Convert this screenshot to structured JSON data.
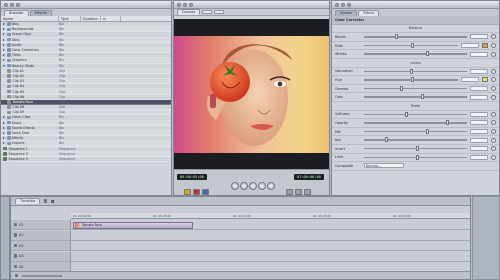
{
  "browser": {
    "tabs": [
      "Browser",
      "Effects"
    ],
    "columns": [
      "Name",
      "Type",
      "Duration",
      "In"
    ],
    "rows": [
      {
        "name": "Bins",
        "type": "Bin",
        "dur": "",
        "icon": "bin",
        "indent": 0,
        "open": false
      },
      {
        "name": "Backgrounds",
        "type": "Bin",
        "dur": "",
        "icon": "bin",
        "indent": 0,
        "open": false
      },
      {
        "name": "Scene Clips",
        "type": "Bin",
        "dur": "",
        "icon": "bin",
        "indent": 0,
        "open": false
      },
      {
        "name": "Stills",
        "type": "Bin",
        "dur": "",
        "icon": "bin",
        "indent": 0,
        "open": false
      },
      {
        "name": "Audio",
        "type": "Bin",
        "dur": "",
        "icon": "bin",
        "indent": 0,
        "open": false
      },
      {
        "name": "Color Correction",
        "type": "Bin",
        "dur": "",
        "icon": "bin",
        "indent": 0,
        "open": false
      },
      {
        "name": "Titles",
        "type": "Bin",
        "dur": "",
        "icon": "bin",
        "indent": 0,
        "open": false
      },
      {
        "name": "Graphics",
        "type": "Bin",
        "dur": "",
        "icon": "bin",
        "indent": 0,
        "open": false
      },
      {
        "name": "Beauty Shots",
        "type": "Bin",
        "dur": "",
        "icon": "bin",
        "indent": 0,
        "open": true
      },
      {
        "name": "Clip 01",
        "type": "Clip",
        "dur": "",
        "icon": "clip",
        "indent": 1,
        "open": false
      },
      {
        "name": "Clip 02",
        "type": "Clip",
        "dur": "",
        "icon": "clip",
        "indent": 1,
        "open": false
      },
      {
        "name": "Clip 03",
        "type": "Clip",
        "dur": "",
        "icon": "clip",
        "indent": 1,
        "open": false
      },
      {
        "name": "Clip 04",
        "type": "Clip",
        "dur": "",
        "icon": "clip",
        "indent": 1,
        "open": false
      },
      {
        "name": "Clip 05",
        "type": "Clip",
        "dur": "",
        "icon": "clip",
        "indent": 1,
        "open": false
      },
      {
        "name": "Clip 06",
        "type": "Clip",
        "dur": "",
        "icon": "clip",
        "indent": 1,
        "open": false
      },
      {
        "name": "Tomato Face",
        "type": "Clip",
        "dur": "",
        "icon": "clip",
        "indent": 1,
        "open": false,
        "selected": true
      },
      {
        "name": "Clip 08",
        "type": "Clip",
        "dur": "",
        "icon": "clip",
        "indent": 1,
        "open": false
      },
      {
        "name": "Clip 09",
        "type": "Clip",
        "dur": "",
        "icon": "clip",
        "indent": 1,
        "open": false
      },
      {
        "name": "Other Clips",
        "type": "Bin",
        "dur": "",
        "icon": "bin",
        "indent": 0,
        "open": false
      },
      {
        "name": "Music",
        "type": "Bin",
        "dur": "",
        "icon": "bin",
        "indent": 0,
        "open": false
      },
      {
        "name": "Sound Effects",
        "type": "Bin",
        "dur": "",
        "icon": "bin",
        "indent": 0,
        "open": false
      },
      {
        "name": "Voice Over",
        "type": "Bin",
        "dur": "",
        "icon": "bin",
        "indent": 0,
        "open": false
      },
      {
        "name": "Effects",
        "type": "Bin",
        "dur": "",
        "icon": "bin",
        "indent": 0,
        "open": false
      },
      {
        "name": "Exports",
        "type": "Bin",
        "dur": "",
        "icon": "bin",
        "indent": 0,
        "open": false
      },
      {
        "name": "Sequence 1",
        "type": "Sequence",
        "dur": "",
        "icon": "seq",
        "indent": 0,
        "open": false
      },
      {
        "name": "Sequence 2",
        "type": "Sequence",
        "dur": "",
        "icon": "seq",
        "indent": 0,
        "open": false
      },
      {
        "name": "Sequence 3",
        "type": "Sequence",
        "dur": "",
        "icon": "seq",
        "indent": 0,
        "open": false
      }
    ]
  },
  "canvas": {
    "tabs": [
      "Canvas"
    ],
    "zoom": "100%",
    "timecode_current": "01:00:00;00",
    "timecode_duration": "00:00:05;00"
  },
  "inspector": {
    "tabs": [
      "Viewer",
      "Filters"
    ],
    "sections": [
      {
        "kind": "header",
        "label": "Color Corrector"
      },
      {
        "kind": "sub",
        "label": "Balance"
      },
      {
        "kind": "row",
        "label": "Blacks",
        "value": "",
        "knob": 0.3,
        "swatch": ""
      },
      {
        "kind": "row",
        "label": "Mids",
        "value": "",
        "knob": 0.5,
        "swatch": "#e59a3a"
      },
      {
        "kind": "row",
        "label": "Whites",
        "value": "",
        "knob": 0.6,
        "swatch": ""
      },
      {
        "kind": "sub",
        "label": "Levels"
      },
      {
        "kind": "row",
        "label": "Saturation",
        "value": "",
        "knob": 0.45,
        "swatch": ""
      },
      {
        "kind": "row",
        "label": "Hue",
        "value": "",
        "knob": 0.5,
        "swatch": "#e8e05a"
      },
      {
        "kind": "row",
        "label": "Gamma",
        "value": "",
        "knob": 0.35,
        "swatch": ""
      },
      {
        "kind": "row",
        "label": "Gain",
        "value": "",
        "knob": 0.55,
        "swatch": ""
      },
      {
        "kind": "sub",
        "label": "Matte"
      },
      {
        "kind": "row",
        "label": "Softness",
        "value": "",
        "knob": 0.4,
        "swatch": ""
      },
      {
        "kind": "row",
        "label": "Opacity",
        "value": "",
        "knob": 0.8,
        "swatch": ""
      },
      {
        "kind": "row",
        "label": "Mix",
        "value": "",
        "knob": 0.6,
        "swatch": ""
      },
      {
        "kind": "row",
        "label": "Key",
        "value": "",
        "knob": 0.2,
        "swatch": ""
      },
      {
        "kind": "row",
        "label": "Invert",
        "value": "",
        "knob": 0.5,
        "swatch": ""
      },
      {
        "kind": "row",
        "label": "Limit",
        "value": "",
        "knob": 0.5,
        "swatch": ""
      },
      {
        "kind": "select",
        "label": "Composite",
        "value": "Normal..."
      }
    ]
  },
  "timeline": {
    "tabs": [
      "Timeline"
    ],
    "ruler": [
      "01:00:00;00",
      "01:00:05;00",
      "01:00:10;00",
      "01:00:15;00",
      "01:00:20;00"
    ],
    "tracks": [
      {
        "label": "V1",
        "clip": "Tomato Face"
      },
      {
        "label": "A1",
        "clip": ""
      },
      {
        "label": "A2",
        "clip": ""
      },
      {
        "label": "A3",
        "clip": ""
      },
      {
        "label": "A4",
        "clip": ""
      }
    ]
  }
}
